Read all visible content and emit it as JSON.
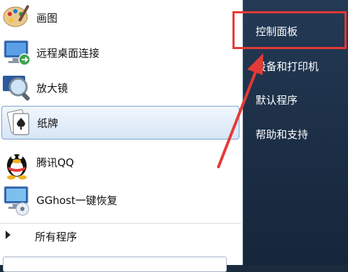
{
  "start_menu": {
    "programs": [
      {
        "label": "画图",
        "icon": "paint-icon"
      },
      {
        "label": "远程桌面连接",
        "icon": "remote-desktop-icon"
      },
      {
        "label": "放大镜",
        "icon": "magnifier-icon"
      },
      {
        "label": "纸牌",
        "icon": "solitaire-icon",
        "selected": true
      },
      {
        "label": "腾讯QQ",
        "icon": "qq-penguin-icon"
      },
      {
        "label": "GGhost一键恢复",
        "icon": "ghost-restore-icon"
      }
    ],
    "all_programs_label": "所有程序"
  },
  "right_pane": {
    "items": [
      {
        "label": "控制面板",
        "highlighted": true
      },
      {
        "label": "设备和打印机"
      },
      {
        "label": "默认程序"
      },
      {
        "label": "帮助和支持"
      }
    ]
  },
  "annotation": {
    "color": "#e53935"
  }
}
